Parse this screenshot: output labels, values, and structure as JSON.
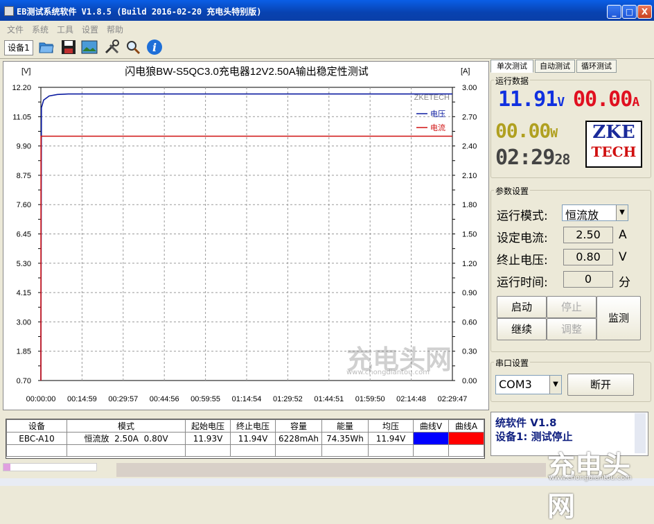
{
  "window": {
    "title": "EB测试系统软件 V1.8.5 (Build 2016-02-20 充电头特别版)",
    "minimize": "_",
    "maximize": "□",
    "close": "X"
  },
  "menu": [
    "文件",
    "系统",
    "工具",
    "设置",
    "帮助"
  ],
  "toolbar": {
    "device_tab": "设备1"
  },
  "chart_data": {
    "type": "line",
    "title": "闪电狼BW-S5QC3.0充电器12V2.50A输出稳定性测试",
    "ylabel_left": "[V]",
    "ylabel_right": "[A]",
    "watermark": "ZKETECH",
    "y_ticks_left": [
      "12.20",
      "11.05",
      "9.90",
      "8.75",
      "7.60",
      "6.45",
      "5.30",
      "4.15",
      "3.00",
      "1.85",
      "0.70"
    ],
    "y_ticks_right": [
      "3.00",
      "2.70",
      "2.40",
      "2.10",
      "1.80",
      "1.50",
      "1.20",
      "0.90",
      "0.60",
      "0.30",
      "0.00"
    ],
    "x_ticks": [
      "00:00:00",
      "00:14:59",
      "00:29:57",
      "00:44:56",
      "00:59:55",
      "01:14:54",
      "01:29:52",
      "01:44:51",
      "01:59:50",
      "02:14:48",
      "02:29:47"
    ],
    "ylim_left": [
      0.7,
      12.2
    ],
    "ylim_right": [
      0.0,
      3.0
    ],
    "grid": true,
    "legend_position": "top-right",
    "series": [
      {
        "name": "电压",
        "axis": "left",
        "color": "#0A1AA0",
        "x_minutes": [
          0,
          0.2,
          1,
          3,
          6,
          10,
          30,
          60,
          90,
          120,
          149.78
        ],
        "values": [
          0.7,
          11.4,
          11.7,
          11.86,
          11.92,
          11.94,
          11.94,
          11.94,
          11.94,
          11.94,
          11.94
        ]
      },
      {
        "name": "电流",
        "axis": "right",
        "color": "#D01010",
        "x_minutes": [
          0,
          0.05,
          0.2,
          149.78
        ],
        "values": [
          0.0,
          2.5,
          2.5,
          2.5
        ]
      }
    ]
  },
  "table": {
    "headers": [
      "设备",
      "模式",
      "起始电压",
      "终止电压",
      "容量",
      "能量",
      "均压",
      "曲线V",
      "曲线A"
    ],
    "rows": [
      [
        "EBC-A10",
        "恒流放  2.50A  0.80V",
        "11.93V",
        "11.94V",
        "6228mAh",
        "74.35Wh",
        "11.94V",
        "",
        ""
      ]
    ],
    "curve_v_color": "#0000FF",
    "curve_a_color": "#FF0000"
  },
  "tabs": [
    "单次测试",
    "自动测试",
    "循环测试"
  ],
  "run_data": {
    "label": "运行数据",
    "voltage": "11.91",
    "voltage_unit": "V",
    "current": "00.00",
    "current_unit": "A",
    "power": "00.00",
    "power_unit": "W",
    "time": "02:29",
    "time_sec": "28",
    "logo_line1": "ZKE",
    "logo_line2": "TECH"
  },
  "params": {
    "label": "参数设置",
    "mode_label": "运行模式:",
    "mode_value": "恒流放",
    "current_label": "设定电流:",
    "current_value": "2.50",
    "current_unit": "A",
    "cutoff_label": "终止电压:",
    "cutoff_value": "0.80",
    "cutoff_unit": "V",
    "time_label": "运行时间:",
    "time_value": "0",
    "time_unit": "分"
  },
  "controls": {
    "start": "启动",
    "stop": "停止",
    "continue": "继续",
    "adjust": "调整",
    "monitor": "监测"
  },
  "serial": {
    "label": "串口设置",
    "port": "COM3",
    "disconnect": "断开"
  },
  "log": {
    "line1": "统软件 V1.8",
    "line2": "设备1: 测试停止"
  },
  "watermark_text": "充电头网",
  "watermark_url": "www.chongdiantou.com"
}
